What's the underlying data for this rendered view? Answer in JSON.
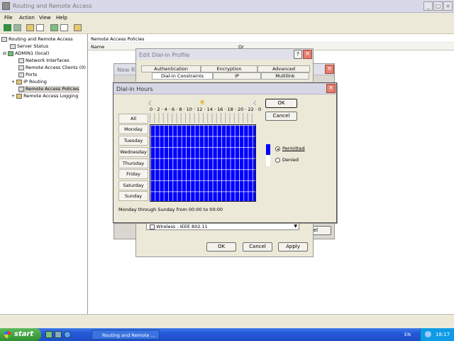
{
  "window": {
    "title": "Routing and Remote Access",
    "min": "_",
    "max": "□",
    "close": "×"
  },
  "menu": {
    "file": "File",
    "action": "Action",
    "view": "View",
    "help": "Help"
  },
  "toolbar": {
    "icons": [
      "back-icon",
      "forward-icon",
      "up-icon",
      "show-hide-tree-icon",
      "properties-icon",
      "refresh-icon",
      "export-icon"
    ]
  },
  "tree": {
    "items": [
      {
        "label": "Routing and Remote Access",
        "icon": "rras-icon"
      },
      {
        "label": "Server Status",
        "icon": "server-status-icon"
      },
      {
        "label": "ADMIN1 (local)",
        "icon": "server-icon"
      },
      {
        "label": "Network Interfaces",
        "icon": "network-icon"
      },
      {
        "label": "Remote Access Clients (0)",
        "icon": "clients-icon"
      },
      {
        "label": "Ports",
        "icon": "ports-icon"
      },
      {
        "label": "IP Routing",
        "icon": "routing-icon"
      },
      {
        "label": "Remote Access Policies",
        "icon": "policy-icon"
      },
      {
        "label": "Remote Access Logging",
        "icon": "logging-icon"
      }
    ]
  },
  "right": {
    "header": "Remote Access Policies",
    "col_name": "Name",
    "col_order": "Or"
  },
  "edit_profile": {
    "title": "Edit Dial-in Profile",
    "tabs": [
      "Authentication",
      "Encryption",
      "Advanced",
      "Dial-in Constraints",
      "IP",
      "Multilink"
    ],
    "port_type": "Wireless - IEEE 802.11",
    "ok": "OK",
    "cancel": "Cancel",
    "apply": "Apply"
  },
  "new_policy": {
    "title": "New R",
    "cancel_partial": "cel"
  },
  "dial_hours": {
    "title": "Dial-in Hours",
    "ok": "OK",
    "cancel": "Cancel",
    "all": "All",
    "days": [
      "Monday",
      "Tuesday",
      "Wednesday",
      "Thursday",
      "Friday",
      "Saturday",
      "Sunday"
    ],
    "hour_ticks": "0 · 2 · 4 · 6 · 8 · 10 · 12 · 14 · 16 · 18 · 20 · 22 · 0",
    "permitted": "Permitted",
    "denied": "Denied",
    "selected": "permitted",
    "summary": "Monday through Sunday from 00:00 to 00:00",
    "permitted_color": "#0000ff"
  },
  "taskbar": {
    "start": "start",
    "task": "Routing and Remote ...",
    "lang": "EN",
    "time": "18:17"
  }
}
